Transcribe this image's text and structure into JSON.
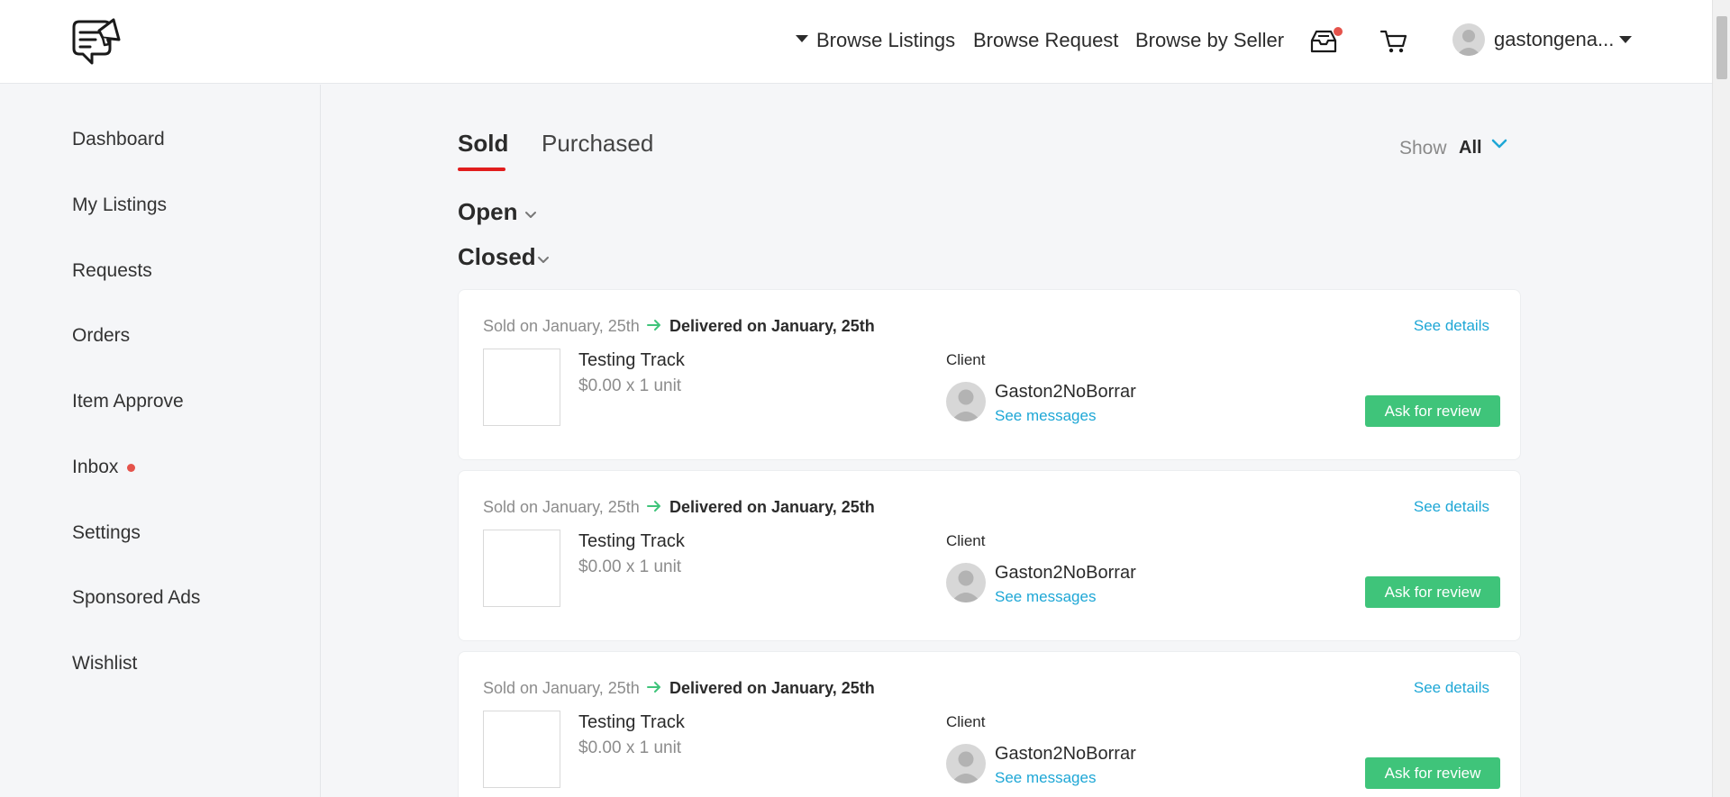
{
  "header": {
    "logo_icon": "megaphone-chat-logo",
    "nav": {
      "browse_listings": "Browse Listings",
      "browse_request": "Browse Request",
      "browse_by_seller": "Browse by Seller"
    },
    "inbox_icon": "inbox-tray-icon",
    "cart_icon": "cart-icon",
    "user_name": "gastongena..."
  },
  "sidebar": {
    "items": [
      {
        "label": "Dashboard"
      },
      {
        "label": "My Listings"
      },
      {
        "label": "Requests"
      },
      {
        "label": "Orders"
      },
      {
        "label": "Item Approve"
      },
      {
        "label": "Inbox"
      },
      {
        "label": "Settings"
      },
      {
        "label": "Sponsored Ads"
      },
      {
        "label": "Wishlist"
      }
    ]
  },
  "tabs": {
    "sold": "Sold",
    "purchased": "Purchased",
    "active": "Sold"
  },
  "filter": {
    "label": "Show",
    "value": "All"
  },
  "sections": {
    "open": "Open",
    "closed": "Closed"
  },
  "orders": [
    {
      "sold_on": "Sold on January, 25th",
      "delivered": "Delivered on January, 25th",
      "see_details": "See details",
      "item_title": "Testing Track",
      "item_price": "$0.00 x 1 unit",
      "client_label": "Client",
      "client_name": "Gaston2NoBorrar",
      "see_messages": "See messages",
      "action": "Ask for review"
    },
    {
      "sold_on": "Sold on January, 25th",
      "delivered": "Delivered on January, 25th",
      "see_details": "See details",
      "item_title": "Testing Track",
      "item_price": "$0.00 x 1 unit",
      "client_label": "Client",
      "client_name": "Gaston2NoBorrar",
      "see_messages": "See messages",
      "action": "Ask for review"
    },
    {
      "sold_on": "Sold on January, 25th",
      "delivered": "Delivered on January, 25th",
      "see_details": "See details",
      "item_title": "Testing Track",
      "item_price": "$0.00 x 1 unit",
      "client_label": "Client",
      "client_name": "Gaston2NoBorrar",
      "see_messages": "See messages",
      "action": "Ask for review"
    }
  ],
  "colors": {
    "accent_red": "#e11d1d",
    "link_blue": "#1ea7d6",
    "success_green": "#3fc47a",
    "notification_red": "#e5534b"
  }
}
